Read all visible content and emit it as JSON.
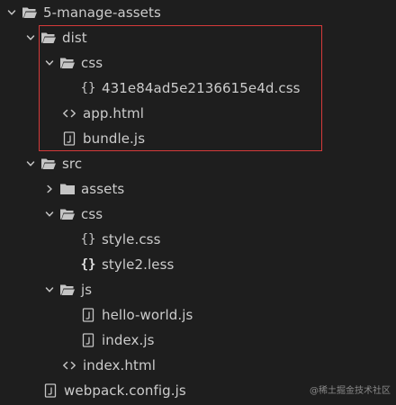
{
  "tree": {
    "root": {
      "label": "5-manage-assets"
    },
    "dist": {
      "label": "dist",
      "css_folder": {
        "label": "css"
      },
      "css_file": {
        "label": "431e84ad5e2136615e4d.css"
      },
      "app_html": {
        "label": "app.html"
      },
      "bundle_js": {
        "label": "bundle.js"
      }
    },
    "src": {
      "label": "src",
      "assets_folder": {
        "label": "assets"
      },
      "css_folder": {
        "label": "css"
      },
      "style_css": {
        "label": "style.css"
      },
      "style2_less": {
        "label": "style2.less"
      },
      "js_folder": {
        "label": "js"
      },
      "hello_world_js": {
        "label": "hello-world.js"
      },
      "index_js": {
        "label": "index.js"
      },
      "index_html": {
        "label": "index.html"
      }
    },
    "webpack_config": {
      "label": "webpack.config.js"
    }
  },
  "watermark": {
    "text": "@稀土掘金技术社区"
  },
  "colors": {
    "background": "#1e1e1e",
    "text": "#cccccc",
    "icon": "#c5c5c5",
    "highlight_border": "#d63a3a"
  }
}
